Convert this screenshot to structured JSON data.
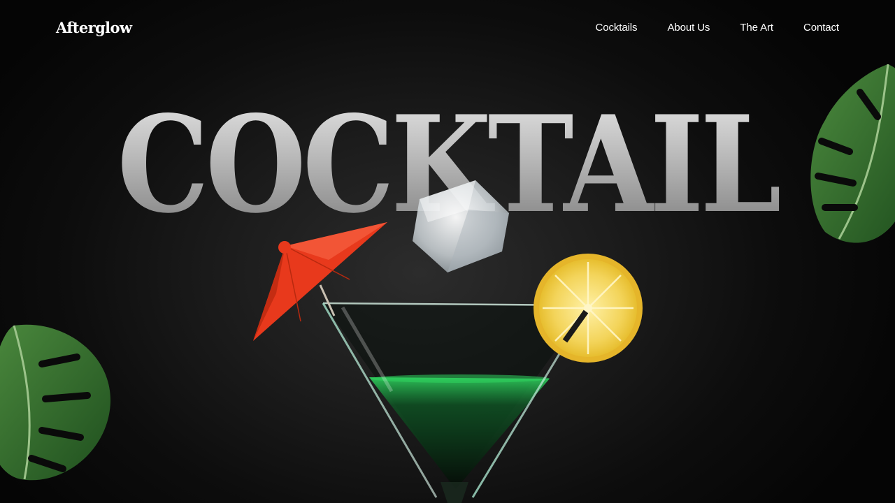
{
  "brand": {
    "logo_text": "Afterglow"
  },
  "nav": {
    "items": [
      {
        "label": "Cocktails"
      },
      {
        "label": "About Us"
      },
      {
        "label": "The Art"
      },
      {
        "label": "Contact"
      }
    ]
  },
  "hero": {
    "title": "COCKTAIL"
  },
  "colors": {
    "background": "#050505",
    "text": "#ffffff",
    "umbrella": "#e8391c",
    "lemon": "#f2d04a",
    "leaf": "#2f6b2a",
    "liquid": "#1fa34a"
  },
  "icons": {
    "umbrella": "cocktail-umbrella-icon",
    "ice": "ice-cube-icon",
    "lemon": "lemon-slice-icon",
    "glass": "martini-glass-icon",
    "leaf": "monstera-leaf-icon"
  }
}
